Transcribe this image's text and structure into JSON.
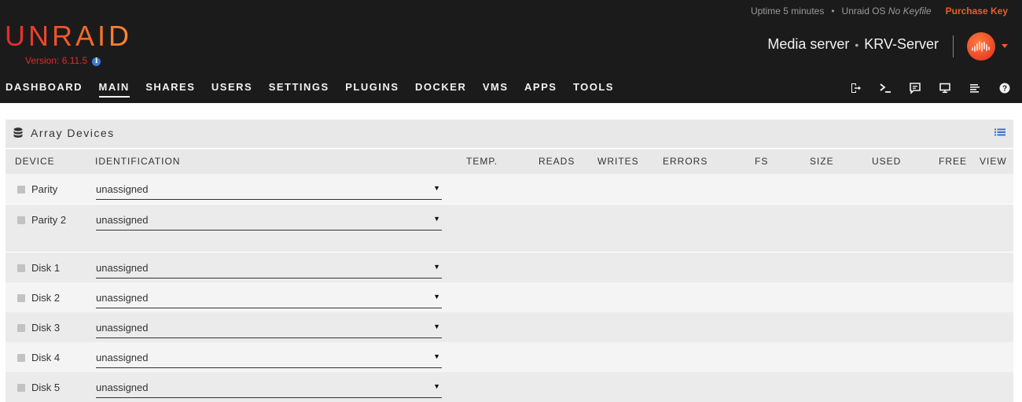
{
  "header": {
    "uptime": "Uptime 5 minutes",
    "separator": "•",
    "os_label": "Unraid OS",
    "key_status": "No Keyfile",
    "purchase": "Purchase Key",
    "logo": "UNRAID",
    "version": "Version: 6.11.5",
    "server_desc": "Media server",
    "server_dot": "•",
    "server_name": "KRV-Server",
    "colors": {
      "accent": "#f15a2c",
      "logo_start": "#e22828",
      "logo_end": "#ff8c2f",
      "bg": "#1c1b1b"
    }
  },
  "nav": {
    "items": [
      "DASHBOARD",
      "MAIN",
      "SHARES",
      "USERS",
      "SETTINGS",
      "PLUGINS",
      "DOCKER",
      "VMS",
      "APPS",
      "TOOLS"
    ],
    "active": "MAIN",
    "icons": [
      "logout-icon",
      "terminal-icon",
      "feedback-icon",
      "monitor-icon",
      "log-icon",
      "help-icon"
    ]
  },
  "panel": {
    "title": "Array Devices",
    "title_icon": "database-icon",
    "view_icon": "list-icon"
  },
  "table": {
    "headers": {
      "device": "DEVICE",
      "identification": "IDENTIFICATION",
      "temp": "TEMP.",
      "reads": "READS",
      "writes": "WRITES",
      "errors": "ERRORS",
      "fs": "FS",
      "size": "SIZE",
      "used": "USED",
      "free": "FREE",
      "view": "VIEW"
    },
    "rows": [
      {
        "device": "Parity",
        "identification": "unassigned"
      },
      {
        "device": "Parity 2",
        "identification": "unassigned"
      },
      {
        "device": "Disk 1",
        "identification": "unassigned"
      },
      {
        "device": "Disk 2",
        "identification": "unassigned"
      },
      {
        "device": "Disk 3",
        "identification": "unassigned"
      },
      {
        "device": "Disk 4",
        "identification": "unassigned"
      },
      {
        "device": "Disk 5",
        "identification": "unassigned"
      }
    ]
  }
}
